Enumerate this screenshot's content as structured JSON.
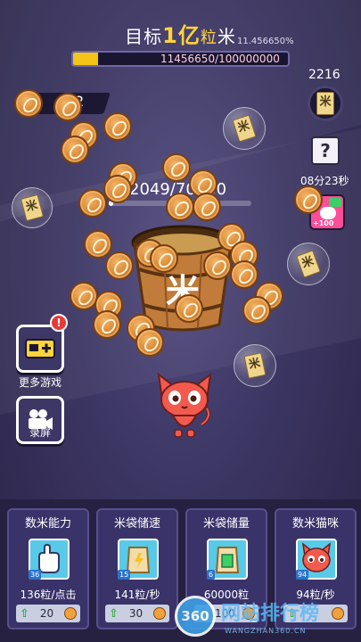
{
  "header": {
    "goal_prefix": "目标",
    "goal_amount": "1亿",
    "goal_unit_mid": "粒",
    "goal_suffix": "米",
    "percent_text": "11.456650%",
    "progress_fraction": 0.1145665,
    "progress_text": "11456650/100000000"
  },
  "top_left": {
    "value_text": "2"
  },
  "right_panel": {
    "rice_count": "2216",
    "rice_badge_glyph": "米",
    "mystery_glyph": "?",
    "mystery_timer": "08分23秒",
    "video_reward_text": "+100"
  },
  "pot": {
    "counter_text": "2049/70000",
    "fraction": 0.02927,
    "bucket_glyph": "米"
  },
  "bubbles": [
    {
      "glyph": "米"
    },
    {
      "glyph": "米"
    },
    {
      "glyph": "米"
    },
    {
      "glyph": "米"
    }
  ],
  "side_buttons": {
    "more_games_label": "更多游戏",
    "more_games_alert": "!",
    "record_label": "录屏"
  },
  "cards": [
    {
      "title": "数米能力",
      "level": "36",
      "stat": "136粒/点击",
      "cost": "20",
      "icon": "hand-icon",
      "icon_color": "#59c9e8"
    },
    {
      "title": "米袋储速",
      "level": "15",
      "stat": "141粒/秒",
      "cost": "30",
      "icon": "rice-bag-speed-icon",
      "icon_color": "#59c9e8"
    },
    {
      "title": "米袋储量",
      "level": "6",
      "stat": "60000粒",
      "cost": "100",
      "icon": "rice-bag-capacity-icon",
      "icon_color": "#59c9e8"
    },
    {
      "title": "数米猫咪",
      "level": "94",
      "stat": "94粒/秒",
      "cost": "",
      "icon": "cat-icon",
      "icon_color": "#59c9e8"
    }
  ],
  "watermark": {
    "circle_text": "360",
    "main_text": "网站排行榜",
    "sub_text": "WANGZHAN360.CN"
  },
  "colors": {
    "accent_gold": "#ffd43a",
    "progress_fill": "#f5c419",
    "card_bg": "#3a336a",
    "alert_red": "#e53a3a"
  }
}
